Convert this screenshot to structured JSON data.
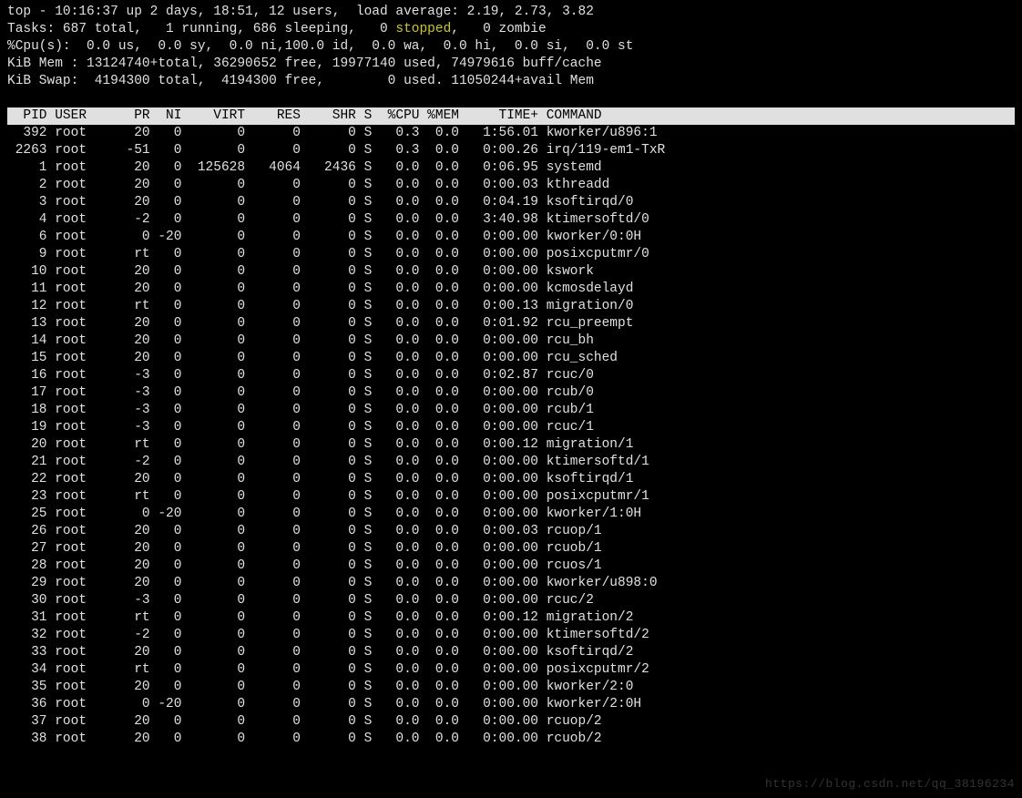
{
  "summary": {
    "line1_a": "top - 10:16:37 up 2 days, 18:51, 12 users,  load average: 2.19, 2.73, 3.82",
    "tasks_a": "Tasks: 687 total,   1 running, 686 sleeping,   0 ",
    "tasks_stopped": "stopped",
    "tasks_b": ",   0 zombie",
    "cpu": "%Cpu(s):  0.0 us,  0.0 sy,  0.0 ni,100.0 id,  0.0 wa,  0.0 hi,  0.0 si,  0.0 st",
    "mem": "KiB Mem : 13124740+total, 36290652 free, 19977140 used, 74979616 buff/cache",
    "swap": "KiB Swap:  4194300 total,  4194300 free,        0 used. 11050244+avail Mem"
  },
  "columns": "  PID USER      PR  NI    VIRT    RES    SHR S  %CPU %MEM     TIME+ COMMAND                                           ",
  "processes": [
    {
      "pid": 392,
      "user": "root",
      "pr": "20",
      "ni": "0",
      "virt": "0",
      "res": "0",
      "shr": "0",
      "s": "S",
      "cpu": "0.3",
      "mem": "0.0",
      "time": "1:56.01",
      "cmd": "kworker/u896:1"
    },
    {
      "pid": 2263,
      "user": "root",
      "pr": "-51",
      "ni": "0",
      "virt": "0",
      "res": "0",
      "shr": "0",
      "s": "S",
      "cpu": "0.3",
      "mem": "0.0",
      "time": "0:00.26",
      "cmd": "irq/119-em1-TxR"
    },
    {
      "pid": 1,
      "user": "root",
      "pr": "20",
      "ni": "0",
      "virt": "125628",
      "res": "4064",
      "shr": "2436",
      "s": "S",
      "cpu": "0.0",
      "mem": "0.0",
      "time": "0:06.95",
      "cmd": "systemd"
    },
    {
      "pid": 2,
      "user": "root",
      "pr": "20",
      "ni": "0",
      "virt": "0",
      "res": "0",
      "shr": "0",
      "s": "S",
      "cpu": "0.0",
      "mem": "0.0",
      "time": "0:00.03",
      "cmd": "kthreadd"
    },
    {
      "pid": 3,
      "user": "root",
      "pr": "20",
      "ni": "0",
      "virt": "0",
      "res": "0",
      "shr": "0",
      "s": "S",
      "cpu": "0.0",
      "mem": "0.0",
      "time": "0:04.19",
      "cmd": "ksoftirqd/0"
    },
    {
      "pid": 4,
      "user": "root",
      "pr": "-2",
      "ni": "0",
      "virt": "0",
      "res": "0",
      "shr": "0",
      "s": "S",
      "cpu": "0.0",
      "mem": "0.0",
      "time": "3:40.98",
      "cmd": "ktimersoftd/0"
    },
    {
      "pid": 6,
      "user": "root",
      "pr": "0",
      "ni": "-20",
      "virt": "0",
      "res": "0",
      "shr": "0",
      "s": "S",
      "cpu": "0.0",
      "mem": "0.0",
      "time": "0:00.00",
      "cmd": "kworker/0:0H"
    },
    {
      "pid": 9,
      "user": "root",
      "pr": "rt",
      "ni": "0",
      "virt": "0",
      "res": "0",
      "shr": "0",
      "s": "S",
      "cpu": "0.0",
      "mem": "0.0",
      "time": "0:00.00",
      "cmd": "posixcputmr/0"
    },
    {
      "pid": 10,
      "user": "root",
      "pr": "20",
      "ni": "0",
      "virt": "0",
      "res": "0",
      "shr": "0",
      "s": "S",
      "cpu": "0.0",
      "mem": "0.0",
      "time": "0:00.00",
      "cmd": "kswork"
    },
    {
      "pid": 11,
      "user": "root",
      "pr": "20",
      "ni": "0",
      "virt": "0",
      "res": "0",
      "shr": "0",
      "s": "S",
      "cpu": "0.0",
      "mem": "0.0",
      "time": "0:00.00",
      "cmd": "kcmosdelayd"
    },
    {
      "pid": 12,
      "user": "root",
      "pr": "rt",
      "ni": "0",
      "virt": "0",
      "res": "0",
      "shr": "0",
      "s": "S",
      "cpu": "0.0",
      "mem": "0.0",
      "time": "0:00.13",
      "cmd": "migration/0"
    },
    {
      "pid": 13,
      "user": "root",
      "pr": "20",
      "ni": "0",
      "virt": "0",
      "res": "0",
      "shr": "0",
      "s": "S",
      "cpu": "0.0",
      "mem": "0.0",
      "time": "0:01.92",
      "cmd": "rcu_preempt"
    },
    {
      "pid": 14,
      "user": "root",
      "pr": "20",
      "ni": "0",
      "virt": "0",
      "res": "0",
      "shr": "0",
      "s": "S",
      "cpu": "0.0",
      "mem": "0.0",
      "time": "0:00.00",
      "cmd": "rcu_bh"
    },
    {
      "pid": 15,
      "user": "root",
      "pr": "20",
      "ni": "0",
      "virt": "0",
      "res": "0",
      "shr": "0",
      "s": "S",
      "cpu": "0.0",
      "mem": "0.0",
      "time": "0:00.00",
      "cmd": "rcu_sched"
    },
    {
      "pid": 16,
      "user": "root",
      "pr": "-3",
      "ni": "0",
      "virt": "0",
      "res": "0",
      "shr": "0",
      "s": "S",
      "cpu": "0.0",
      "mem": "0.0",
      "time": "0:02.87",
      "cmd": "rcuc/0"
    },
    {
      "pid": 17,
      "user": "root",
      "pr": "-3",
      "ni": "0",
      "virt": "0",
      "res": "0",
      "shr": "0",
      "s": "S",
      "cpu": "0.0",
      "mem": "0.0",
      "time": "0:00.00",
      "cmd": "rcub/0"
    },
    {
      "pid": 18,
      "user": "root",
      "pr": "-3",
      "ni": "0",
      "virt": "0",
      "res": "0",
      "shr": "0",
      "s": "S",
      "cpu": "0.0",
      "mem": "0.0",
      "time": "0:00.00",
      "cmd": "rcub/1"
    },
    {
      "pid": 19,
      "user": "root",
      "pr": "-3",
      "ni": "0",
      "virt": "0",
      "res": "0",
      "shr": "0",
      "s": "S",
      "cpu": "0.0",
      "mem": "0.0",
      "time": "0:00.00",
      "cmd": "rcuc/1"
    },
    {
      "pid": 20,
      "user": "root",
      "pr": "rt",
      "ni": "0",
      "virt": "0",
      "res": "0",
      "shr": "0",
      "s": "S",
      "cpu": "0.0",
      "mem": "0.0",
      "time": "0:00.12",
      "cmd": "migration/1"
    },
    {
      "pid": 21,
      "user": "root",
      "pr": "-2",
      "ni": "0",
      "virt": "0",
      "res": "0",
      "shr": "0",
      "s": "S",
      "cpu": "0.0",
      "mem": "0.0",
      "time": "0:00.00",
      "cmd": "ktimersoftd/1"
    },
    {
      "pid": 22,
      "user": "root",
      "pr": "20",
      "ni": "0",
      "virt": "0",
      "res": "0",
      "shr": "0",
      "s": "S",
      "cpu": "0.0",
      "mem": "0.0",
      "time": "0:00.00",
      "cmd": "ksoftirqd/1"
    },
    {
      "pid": 23,
      "user": "root",
      "pr": "rt",
      "ni": "0",
      "virt": "0",
      "res": "0",
      "shr": "0",
      "s": "S",
      "cpu": "0.0",
      "mem": "0.0",
      "time": "0:00.00",
      "cmd": "posixcputmr/1"
    },
    {
      "pid": 25,
      "user": "root",
      "pr": "0",
      "ni": "-20",
      "virt": "0",
      "res": "0",
      "shr": "0",
      "s": "S",
      "cpu": "0.0",
      "mem": "0.0",
      "time": "0:00.00",
      "cmd": "kworker/1:0H"
    },
    {
      "pid": 26,
      "user": "root",
      "pr": "20",
      "ni": "0",
      "virt": "0",
      "res": "0",
      "shr": "0",
      "s": "S",
      "cpu": "0.0",
      "mem": "0.0",
      "time": "0:00.03",
      "cmd": "rcuop/1"
    },
    {
      "pid": 27,
      "user": "root",
      "pr": "20",
      "ni": "0",
      "virt": "0",
      "res": "0",
      "shr": "0",
      "s": "S",
      "cpu": "0.0",
      "mem": "0.0",
      "time": "0:00.00",
      "cmd": "rcuob/1"
    },
    {
      "pid": 28,
      "user": "root",
      "pr": "20",
      "ni": "0",
      "virt": "0",
      "res": "0",
      "shr": "0",
      "s": "S",
      "cpu": "0.0",
      "mem": "0.0",
      "time": "0:00.00",
      "cmd": "rcuos/1"
    },
    {
      "pid": 29,
      "user": "root",
      "pr": "20",
      "ni": "0",
      "virt": "0",
      "res": "0",
      "shr": "0",
      "s": "S",
      "cpu": "0.0",
      "mem": "0.0",
      "time": "0:00.00",
      "cmd": "kworker/u898:0"
    },
    {
      "pid": 30,
      "user": "root",
      "pr": "-3",
      "ni": "0",
      "virt": "0",
      "res": "0",
      "shr": "0",
      "s": "S",
      "cpu": "0.0",
      "mem": "0.0",
      "time": "0:00.00",
      "cmd": "rcuc/2"
    },
    {
      "pid": 31,
      "user": "root",
      "pr": "rt",
      "ni": "0",
      "virt": "0",
      "res": "0",
      "shr": "0",
      "s": "S",
      "cpu": "0.0",
      "mem": "0.0",
      "time": "0:00.12",
      "cmd": "migration/2"
    },
    {
      "pid": 32,
      "user": "root",
      "pr": "-2",
      "ni": "0",
      "virt": "0",
      "res": "0",
      "shr": "0",
      "s": "S",
      "cpu": "0.0",
      "mem": "0.0",
      "time": "0:00.00",
      "cmd": "ktimersoftd/2"
    },
    {
      "pid": 33,
      "user": "root",
      "pr": "20",
      "ni": "0",
      "virt": "0",
      "res": "0",
      "shr": "0",
      "s": "S",
      "cpu": "0.0",
      "mem": "0.0",
      "time": "0:00.00",
      "cmd": "ksoftirqd/2"
    },
    {
      "pid": 34,
      "user": "root",
      "pr": "rt",
      "ni": "0",
      "virt": "0",
      "res": "0",
      "shr": "0",
      "s": "S",
      "cpu": "0.0",
      "mem": "0.0",
      "time": "0:00.00",
      "cmd": "posixcputmr/2"
    },
    {
      "pid": 35,
      "user": "root",
      "pr": "20",
      "ni": "0",
      "virt": "0",
      "res": "0",
      "shr": "0",
      "s": "S",
      "cpu": "0.0",
      "mem": "0.0",
      "time": "0:00.00",
      "cmd": "kworker/2:0"
    },
    {
      "pid": 36,
      "user": "root",
      "pr": "0",
      "ni": "-20",
      "virt": "0",
      "res": "0",
      "shr": "0",
      "s": "S",
      "cpu": "0.0",
      "mem": "0.0",
      "time": "0:00.00",
      "cmd": "kworker/2:0H"
    },
    {
      "pid": 37,
      "user": "root",
      "pr": "20",
      "ni": "0",
      "virt": "0",
      "res": "0",
      "shr": "0",
      "s": "S",
      "cpu": "0.0",
      "mem": "0.0",
      "time": "0:00.00",
      "cmd": "rcuop/2"
    },
    {
      "pid": 38,
      "user": "root",
      "pr": "20",
      "ni": "0",
      "virt": "0",
      "res": "0",
      "shr": "0",
      "s": "S",
      "cpu": "0.0",
      "mem": "0.0",
      "time": "0:00.00",
      "cmd": "rcuob/2"
    }
  ],
  "watermark": "https://blog.csdn.net/qq_38196234"
}
